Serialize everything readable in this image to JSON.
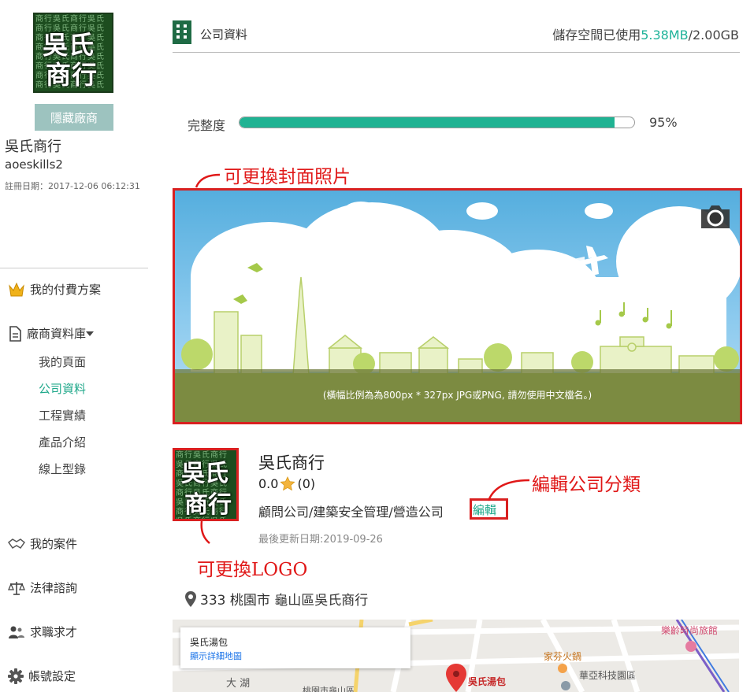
{
  "sidebar": {
    "hide_button": "隱藏廠商",
    "company_name": "吳氏商行",
    "username": "aoeskills2",
    "register_date": "註冊日期：2017-12-06 06:12:31",
    "nav": {
      "plans": "我的付費方案",
      "database": "廠商資料庫",
      "cases": "我的案件",
      "legal": "法律諮詢",
      "jobs": "求職求才",
      "account": "帳號設定"
    },
    "sub_items": [
      "我的頁面",
      "公司資料",
      "工程實績",
      "產品介紹",
      "線上型錄"
    ]
  },
  "logo": {
    "line1": "吳氏",
    "line2": "商行",
    "background_text": "商行吳氏商行吳氏商行吳氏商行吳氏商行吳氏商行吳氏商行吳氏商行吳氏商行吳氏商行吳氏商行吳氏商行吳氏商行吳氏商行吳氏商行吳氏商行吳氏"
  },
  "header": {
    "title": "公司資料",
    "storage_prefix": "儲存空間已使用",
    "storage_used": "5.38MB",
    "storage_total": "/2.00GB"
  },
  "progress": {
    "label": "完整度",
    "value": 95,
    "text": "95%"
  },
  "annotations": {
    "cover": "可更換封面照片",
    "category": "編輯公司分類",
    "logo": "可更換LOGO"
  },
  "cover": {
    "hint": "(橫幅比例為為800px * 327px JPG或PNG, 請勿使用中文檔名。)"
  },
  "company": {
    "name": "吳氏商行",
    "rating": "0.0",
    "rating_count": "(0)",
    "category": "顧問公司/建築安全管理/營造公司",
    "edit": "編輯",
    "updated": "最後更新日期:2019-09-26",
    "address": "333 桃園市 龜山區吳氏商行"
  },
  "map": {
    "card_title": "吳氏湯包",
    "card_link": "顯示詳細地圖",
    "pin_label": "吳氏湯包",
    "place1": "家芬火鍋",
    "place2": "華亞科技園區",
    "place3": "樂齡時尚旅館",
    "place4": "大 湖",
    "place5": "桃園市龜山區"
  },
  "colors": {
    "accent": "#1fa88a",
    "annotation_red": "#e01818",
    "progress_fill": "#20b393"
  }
}
